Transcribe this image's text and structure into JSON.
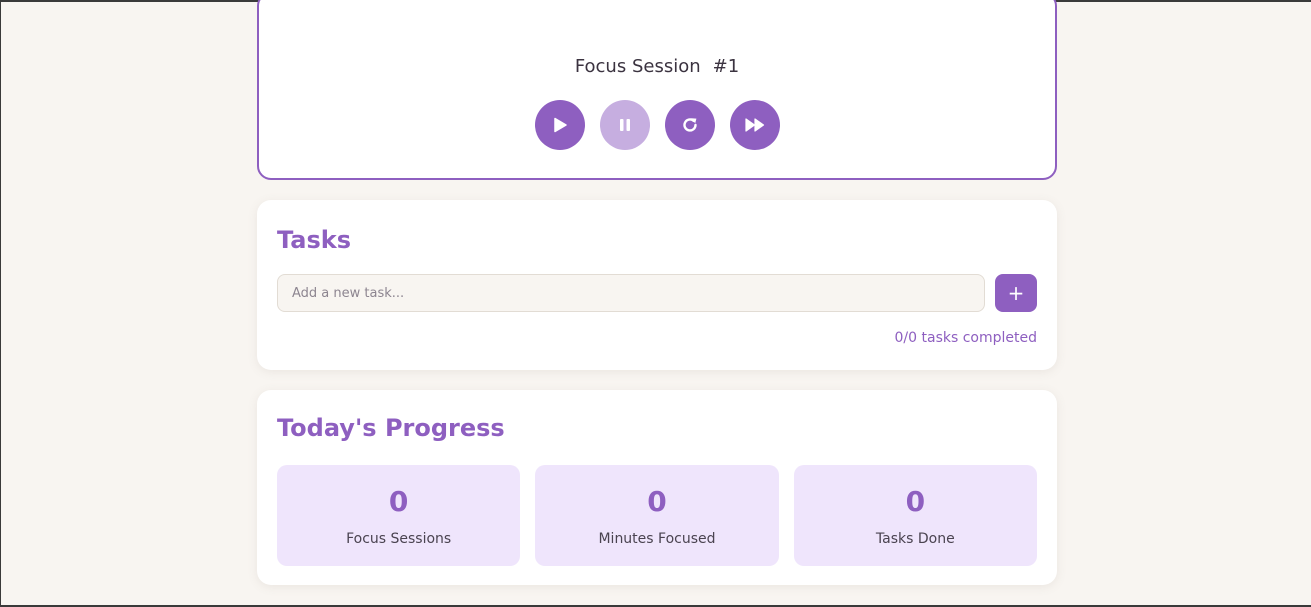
{
  "timer": {
    "session_label": "Focus Session",
    "session_number": "#1",
    "controls": [
      {
        "name": "play",
        "icon": "play-icon",
        "enabled": true
      },
      {
        "name": "pause",
        "icon": "pause-icon",
        "enabled": false
      },
      {
        "name": "reset",
        "icon": "reset-icon",
        "enabled": true
      },
      {
        "name": "skip",
        "icon": "skip-forward-icon",
        "enabled": true
      }
    ]
  },
  "tasks": {
    "title": "Tasks",
    "input_placeholder": "Add a new task...",
    "input_value": "",
    "add_label": "+",
    "summary": "0/0 tasks completed"
  },
  "progress": {
    "title": "Today's Progress",
    "stats": [
      {
        "value": "0",
        "label": "Focus Sessions"
      },
      {
        "value": "0",
        "label": "Minutes Focused"
      },
      {
        "value": "0",
        "label": "Tasks Done"
      }
    ]
  },
  "colors": {
    "accent": "#8e5fc0",
    "accent_disabled": "#c6aee0",
    "background": "#f8f5f1",
    "stat_bg": "#efe5fc"
  }
}
